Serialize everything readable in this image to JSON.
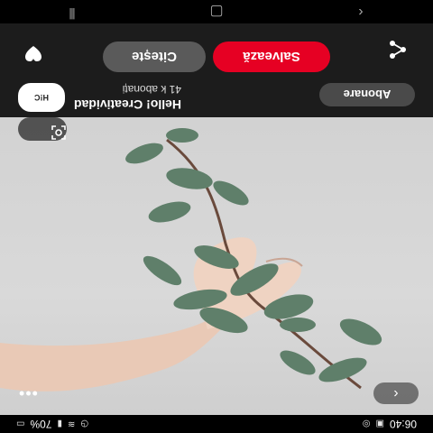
{
  "status_bar": {
    "time": "06:40",
    "battery": "70%",
    "left_icons": [
      "image-icon",
      "whatsapp-icon"
    ],
    "right_icons": [
      "alarm-icon",
      "wifi-icon",
      "signal-icon",
      "battery-icon"
    ]
  },
  "pin": {
    "creator_name": "Hello! Creatividad",
    "subscribers": "41 k abonați",
    "avatar_text": "H!C",
    "follow_label": "Abonare"
  },
  "actions": {
    "save_label": "Salvează",
    "visit_label": "Citește",
    "save_color": "#e60023"
  },
  "overlay": {
    "back_icon": "chevron-left-icon",
    "more_icon": "more-horizontal-icon",
    "lens_icon": "visual-search-icon"
  },
  "nav": {
    "items": [
      "back-nav-icon",
      "home-nav-icon",
      "recents-nav-icon"
    ]
  }
}
